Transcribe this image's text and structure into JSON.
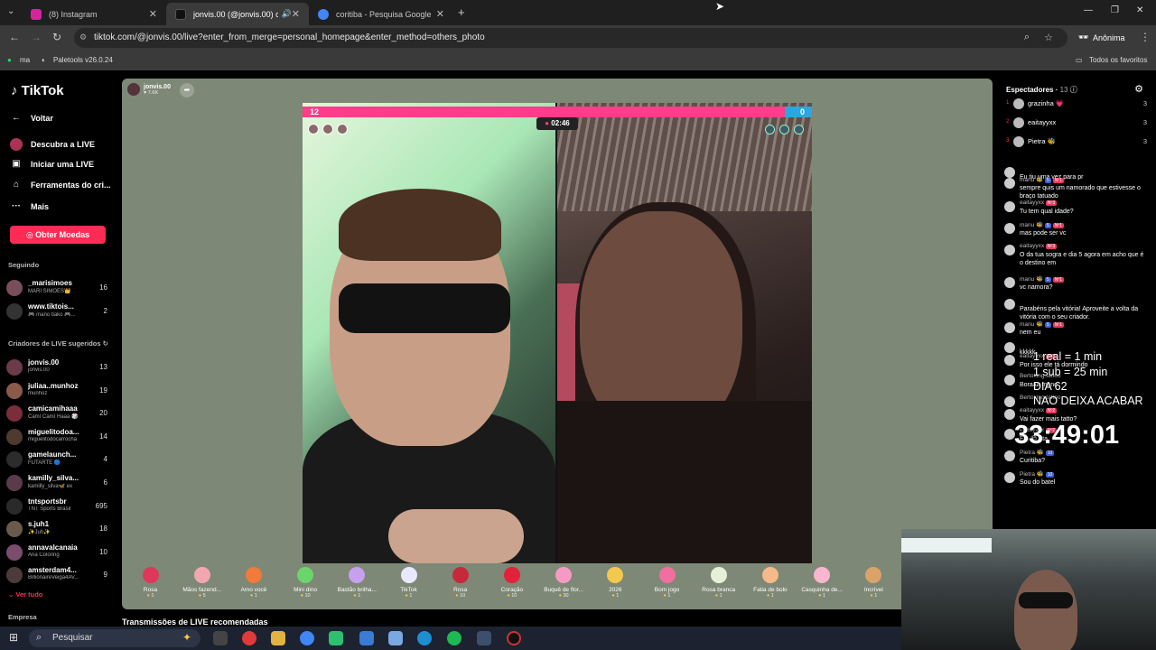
{
  "tabs": [
    {
      "label": "(8) Instagram",
      "active": false,
      "color": "#d6249f"
    },
    {
      "label": "jonvis.00 (@jonvis.00) com",
      "active": true,
      "color": "#111111"
    },
    {
      "label": "coritiba - Pesquisa Google",
      "active": false,
      "color": "#4285f4"
    }
  ],
  "address": {
    "url": "tiktok.com/@jonvis.00/live?enter_from_merge=personal_homepage&enter_method=others_photo",
    "profile": "Anônima"
  },
  "bookmarks": {
    "b1": "ma",
    "b2": "Paletools v26.0.24",
    "all": "Todos os favoritos"
  },
  "sidebar": {
    "logo": "TikTok",
    "nav": [
      {
        "label": "Voltar",
        "icon": "back-arrow-icon"
      },
      {
        "label": "Descubra a LIVE",
        "icon": "live-avatar-icon"
      },
      {
        "label": "Iniciar uma LIVE",
        "icon": "camera-icon"
      },
      {
        "label": "Ferramentas do cri...",
        "icon": "home-icon"
      },
      {
        "label": "Mais",
        "icon": "more-icon"
      }
    ],
    "coins_button": "Obter Moedas",
    "following_header": "Seguindo",
    "following": [
      {
        "name": "_marisimoes",
        "sub": "MARI SIMÕES👑",
        "count": "16"
      },
      {
        "name": "www.tiktois...",
        "sub": "🎮 mano tiako 🎮...",
        "count": "2"
      }
    ],
    "creators_header": "Criadores de LIVE sugeridos",
    "creators": [
      {
        "name": "jonvis.00",
        "sub": "jonvis.00",
        "count": "13"
      },
      {
        "name": "juliaa..munhoz",
        "sub": "munhoz",
        "count": "19"
      },
      {
        "name": "camicamihaaa",
        "sub": "Camí Camí Haaa 🎲",
        "count": "20"
      },
      {
        "name": "miguelitodoa...",
        "sub": "miguelitodocarrocha",
        "count": "14"
      },
      {
        "name": "gamelaunch...",
        "sub": "FUTARTE 🔵",
        "count": "4"
      },
      {
        "name": "kamilly_silva...",
        "sub": "kamilly_silva🦋 ex",
        "count": "6"
      },
      {
        "name": "tntsportsbr",
        "sub": "TNT Sports Brasil",
        "count": "695"
      },
      {
        "name": "s.juh1",
        "sub": "✨Juh✨",
        "count": "18"
      },
      {
        "name": "annavalcanaia",
        "sub": "Ana Coloring",
        "count": "10"
      },
      {
        "name": "amsterdam4...",
        "sub": "BillionaireVeiga4AV...",
        "count": "9"
      }
    ],
    "see_all": "Ver tudo",
    "footer": "Empresa"
  },
  "stream": {
    "host": "jonvis.00",
    "host_likes": "7.6K",
    "score_left": "12",
    "score_right": "0",
    "timer": "02:46",
    "gifts": [
      {
        "name": "Rosa",
        "price": "1",
        "color": "#e0365b"
      },
      {
        "name": "Mãos fazend...",
        "price": "5",
        "color": "#f2a7b0"
      },
      {
        "name": "Amo você",
        "price": "1",
        "color": "#f27a3a"
      },
      {
        "name": "Mini dino",
        "price": "10",
        "color": "#6bd46b"
      },
      {
        "name": "Bastão brilha...",
        "price": "1",
        "color": "#c7a0f0"
      },
      {
        "name": "TikTok",
        "price": "1",
        "color": "#e8e8ff"
      },
      {
        "name": "Rosa",
        "price": "10",
        "color": "#c8283c"
      },
      {
        "name": "Coração",
        "price": "10",
        "color": "#e4213a"
      },
      {
        "name": "Buquê de flor...",
        "price": "30",
        "color": "#f59ac4"
      },
      {
        "name": "2026",
        "price": "1",
        "color": "#f2c94c"
      },
      {
        "name": "Bom jogo",
        "price": "1",
        "color": "#f06fa0"
      },
      {
        "name": "Rosa branca",
        "price": "1",
        "color": "#e6f0d8"
      },
      {
        "name": "Fatia de bolo",
        "price": "1",
        "color": "#f6b98a"
      },
      {
        "name": "Casquinha de...",
        "price": "1",
        "color": "#f8b6cf"
      },
      {
        "name": "Incrível",
        "price": "1",
        "color": "#d9a36a"
      }
    ]
  },
  "recommended": "Transmissões de LIVE recomendadas",
  "viewers": {
    "header": "Espectadores",
    "count": "13",
    "list": [
      {
        "rank": "1",
        "name": "grazinha 💗",
        "num": "3"
      },
      {
        "rank": "2",
        "name": "eaitayyxx",
        "num": "3"
      },
      {
        "rank": "3",
        "name": "Pietra 🐝",
        "num": "3"
      }
    ]
  },
  "chat": [
    {
      "user": "",
      "badges": [],
      "text": "Eu tiu uma vez para pr"
    },
    {
      "user": "manu 🐝",
      "badges": [
        "5",
        "Nº1"
      ],
      "text": "sempre quis um namorado que estivesse o braço tatuado"
    },
    {
      "user": "eaitayyxx",
      "badges": [
        "Nº3"
      ],
      "text": "Tu tem qual idade?"
    },
    {
      "user": "manu 🐝",
      "badges": [
        "5",
        "Nº1"
      ],
      "text": "mas pode ser vc"
    },
    {
      "user": "eaitayyxx",
      "badges": [
        "Nº3"
      ],
      "text": "O da tua sogra e dia 5 agora em acho que é o destino em"
    },
    {
      "user": "manu 🐝",
      "badges": [
        "5",
        "Nº1"
      ],
      "text": "vc namora?"
    },
    {
      "user": "",
      "badges": [],
      "text": "Parabéns pela vitória! Aproveite a volta da vitória com o seu criador."
    },
    {
      "user": "manu 🐝",
      "badges": [
        "5",
        "Nº1"
      ],
      "text": "nem eu"
    },
    {
      "user": "",
      "badges": [],
      "text": "kkkkk"
    },
    {
      "user": "eaitayyxx",
      "badges": [
        "Nº2"
      ],
      "text": "Por isso ele tá dormindo"
    },
    {
      "user": "Bertoking.tattoo",
      "badges": [],
      "text": "Boraaa mano"
    },
    {
      "user": "Bertoking.tattoo",
      "badges": [],
      "text": ""
    },
    {
      "user": "eaitayyxx",
      "badges": [
        "Nº2"
      ],
      "text": "Vai fazer mais tatto?"
    },
    {
      "user": "eaitayyxx",
      "badges": [
        "Nº2"
      ],
      "text": "Ela 😊 ata"
    },
    {
      "user": "Pietra 🐝",
      "badges": [
        "10"
      ],
      "text": "Curitiba?"
    },
    {
      "user": "Pietra 🐝",
      "badges": [
        "10"
      ],
      "text": "Sou do batel"
    }
  ],
  "overlay": {
    "line1": "1 real = 1 min",
    "line2": "1 sub = 25 min",
    "line3": "DIA 62",
    "line4": "NAO DEIXA ACABAR",
    "clock": "33:49:01"
  },
  "taskbar": {
    "search": "Pesquisar"
  },
  "colors": {
    "accent": "#fe2c55",
    "stage_bg": "#7d8876",
    "battle_pink": "#ff3d8a",
    "battle_blue": "#2aa7e0"
  }
}
